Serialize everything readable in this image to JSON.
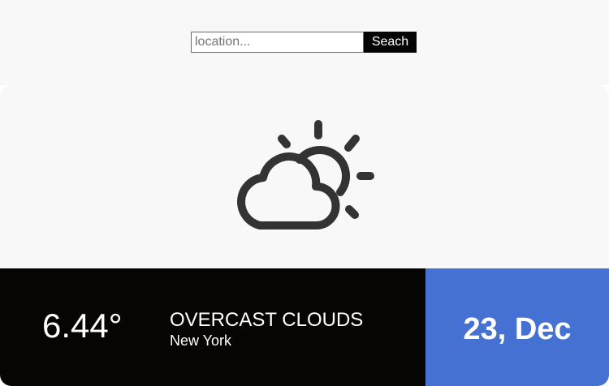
{
  "search": {
    "placeholder": "location...",
    "button_label": "Seach"
  },
  "weather": {
    "icon": "partly-cloudy-icon",
    "temperature": "6.44°",
    "description": "OVERCAST CLOUDS",
    "city": "New York",
    "date": "23, Dec"
  },
  "colors": {
    "date_panel": "#4471d2",
    "info_panel": "#060504",
    "card_background": "#f8f8f8",
    "icon": "#333333"
  }
}
